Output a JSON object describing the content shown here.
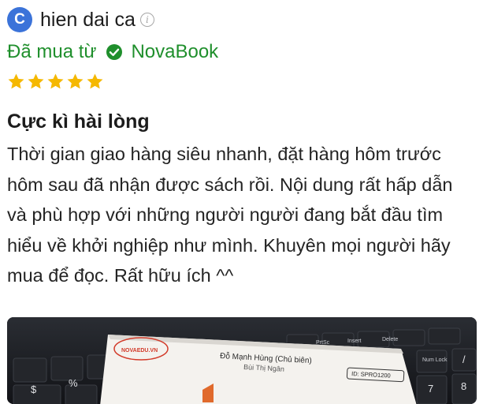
{
  "user": {
    "avatar_letter": "C",
    "name": "hien dai ca",
    "info_icon": "info-icon"
  },
  "purchase": {
    "label": "Đã mua từ",
    "store": "NovaBook",
    "verified_icon": "check-circle-icon"
  },
  "rating": {
    "stars": 5,
    "max": 5,
    "color": "#f5b800"
  },
  "review": {
    "title": "Cực kì hài lòng",
    "lines": [
      "Thời gian giao hàng siêu nhanh, đặt hàng hôm trước",
      "hôm sau đã nhận được sách rồi. Nội dung rất hấp dẫn",
      "và phù hợp với những người người đang bắt đầu tìm",
      "hiểu về khởi nghiệp như mình. Khuyên mọi người hãy",
      "mua để đọc. Rất hữu ích ^^"
    ]
  },
  "photo": {
    "card_logo": "NOVAEDU.VN",
    "card_author": "Đỗ Mạnh Hùng (Chủ biên)",
    "card_coauthor": "Bùi Thị Ngân",
    "card_id": "ID: SPRO1200",
    "keys": [
      "PrtSc",
      "Insert",
      "Delete",
      "Num Lock",
      "7",
      "8",
      "/",
      "%",
      "$"
    ]
  },
  "colors": {
    "accent_green": "#1f8f2c",
    "avatar_blue": "#3b73d9",
    "star_gold": "#f5b800"
  }
}
